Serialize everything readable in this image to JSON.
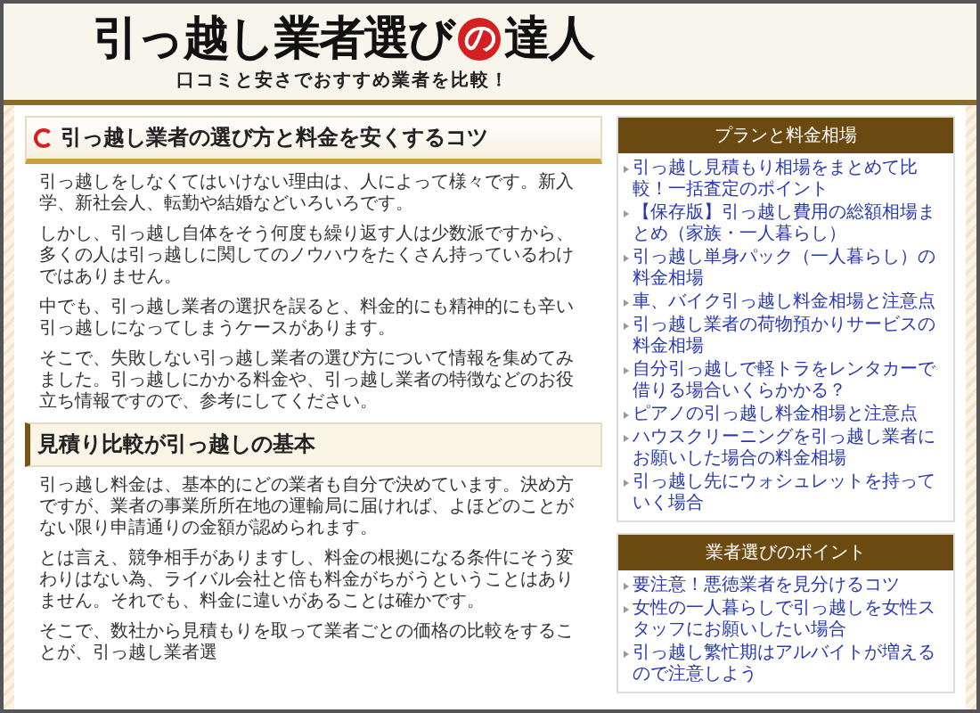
{
  "header": {
    "title_before": "引っ越し業者選び",
    "title_mark": "の",
    "title_after": "達人",
    "tagline": "口コミと安さでおすすめ業者を比較！"
  },
  "main": {
    "sections": [
      {
        "kind": "primary",
        "heading": "引っ越し業者の選び方と料金を安くするコツ",
        "paragraphs": [
          "引っ越しをしなくてはいけない理由は、人によって様々です。新入学、新社会人、転勤や結婚などいろいろです。",
          "しかし、引っ越し自体をそう何度も繰り返す人は少数派ですから、多くの人は引っ越しに関してのノウハウをたくさん持っているわけではありません。",
          "中でも、引っ越し業者の選択を誤ると、料金的にも精神的にも辛い引っ越しになってしまうケースがあります。",
          "そこで、失敗しない引っ越し業者の選び方について情報を集めてみました。引っ越しにかかる料金や、引っ越し業者の特徴などのお役立ち情報ですので、参考にしてください。"
        ]
      },
      {
        "kind": "secondary",
        "heading": "見積り比較が引っ越しの基本",
        "paragraphs": [
          "引っ越し料金は、基本的にどの業者も自分で決めています。決め方ですが、業者の事業所所在地の運輸局に届ければ、よほどのことがない限り申請通りの金額が認められます。",
          "とは言え、競争相手がありますし、料金の根拠になる条件にそう変わりはない為、ライバル会社と倍も料金がちがうということはありません。それでも、料金に違いがあることは確かです。",
          "そこで、数社から見積もりを取って業者ごとの価格の比較をすることが、引っ越し業者選"
        ]
      }
    ]
  },
  "sidebar": [
    {
      "title": "プランと料金相場",
      "links": [
        "引っ越し見積もり相場をまとめて比較！一括査定のポイント",
        "【保存版】引っ越し費用の総額相場まとめ（家族・一人暮らし）",
        "引っ越し単身パック（一人暮らし）の料金相場",
        "車、バイク引っ越し料金相場と注意点",
        "引っ越し業者の荷物預かりサービスの料金相場",
        "自分引っ越しで軽トラをレンタカーで借りる場合いくらかかる？",
        "ピアノの引っ越し料金相場と注意点",
        "ハウスクリーニングを引っ越し業者にお願いした場合の料金相場",
        "引っ越し先にウォシュレットを持っていく場合"
      ]
    },
    {
      "title": "業者選びのポイント",
      "links": [
        "要注意！悪徳業者を見分けるコツ",
        "女性の一人暮らしで引っ越しを女性スタッフにお願いしたい場合",
        "引っ越し繁忙期はアルバイトが増えるので注意しよう"
      ]
    }
  ]
}
